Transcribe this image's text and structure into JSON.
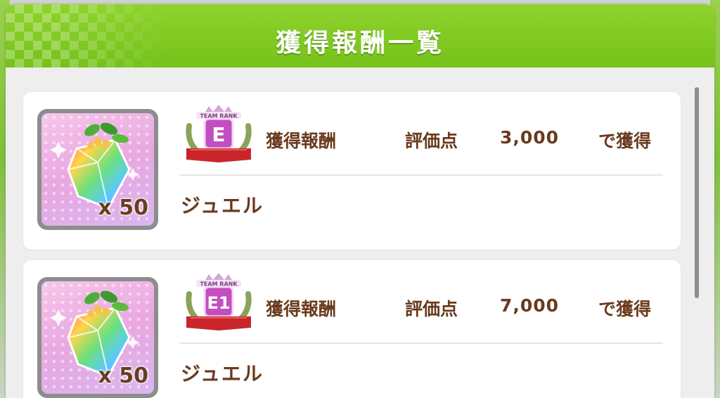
{
  "header": {
    "title": "獲得報酬一覧"
  },
  "colors": {
    "header_green": "#7fc623",
    "text_brown": "#6a3a1e",
    "rank_pink": "#c24ec0",
    "ribbon_red": "#c8262a"
  },
  "rewards": [
    {
      "rank_badge_top": "TEAM RANK",
      "rank": "E",
      "reward_label": "獲得報酬",
      "score_label": "評価点",
      "score_value": "3,000",
      "suffix": "で獲得",
      "item_name": "ジュエル",
      "quantity": "x 50",
      "icon": "jewel-icon"
    },
    {
      "rank_badge_top": "TEAM RANK",
      "rank": "E1",
      "reward_label": "獲得報酬",
      "score_label": "評価点",
      "score_value": "7,000",
      "suffix": "で獲得",
      "item_name": "ジュエル",
      "quantity": "x 50",
      "icon": "jewel-icon"
    }
  ]
}
